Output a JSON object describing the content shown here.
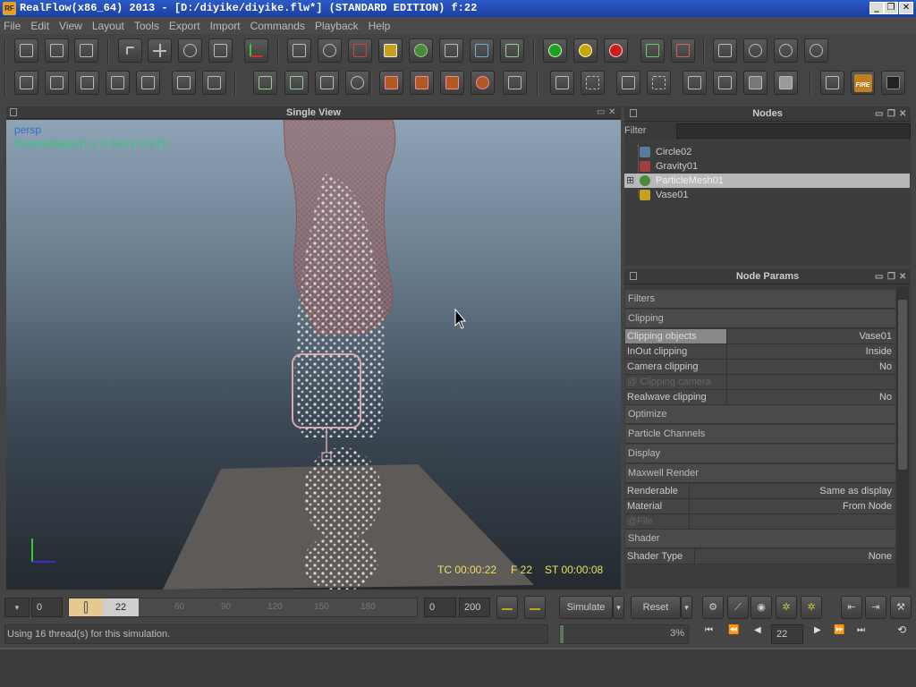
{
  "window": {
    "title": "RealFlow(x86_64) 2013 - [D:/diyike/diyike.flw*] (STANDARD EDITION) f:22",
    "logo_text": "RF"
  },
  "menu": [
    "File",
    "Edit",
    "View",
    "Layout",
    "Tools",
    "Export",
    "Import",
    "Commands",
    "Playback",
    "Help"
  ],
  "viewport": {
    "title": "Single View",
    "camera": "persp",
    "node_info": "ParticleMesh01 V 4 650 F 0 672",
    "timecode": "TC 00:00:22",
    "frame": "F 22",
    "sim_time": "ST 00:00:08"
  },
  "nodes": {
    "title": "Nodes",
    "filter_label": "Filter",
    "filter_value": "",
    "items": [
      {
        "name": "Circle02",
        "icon": "circle-emitter-icon",
        "color": "#5a7aa0",
        "selected": false
      },
      {
        "name": "Gravity01",
        "icon": "gravity-daemon-icon",
        "color": "#a04040",
        "selected": false
      },
      {
        "name": "ParticleMesh01",
        "icon": "particle-mesh-icon",
        "color": "#4a8a3a",
        "selected": true
      },
      {
        "name": "Vase01",
        "icon": "object-cube-icon",
        "color": "#c8a020",
        "selected": false
      }
    ]
  },
  "params": {
    "title": "Node Params",
    "sections": {
      "filters": "Filters",
      "clipping": "Clipping",
      "optimize": "Optimize",
      "channels": "Particle Channels",
      "display": "Display",
      "maxwell": "Maxwell Render",
      "shader": "Shader"
    },
    "clipping_rows": [
      {
        "key": "Clipping objects",
        "value": "Vase01"
      },
      {
        "key": "InOut clipping",
        "value": "Inside"
      },
      {
        "key": "Camera clipping",
        "value": "No"
      },
      {
        "key": "@ Clipping camera",
        "value": ""
      },
      {
        "key": "Realwave clipping",
        "value": "No"
      }
    ],
    "maxwell_rows": [
      {
        "key": "Renderable",
        "value": "Same as display"
      },
      {
        "key": "Material",
        "value": "From Node"
      },
      {
        "key": "@File",
        "value": ""
      }
    ],
    "shader_rows": [
      {
        "key": "Shader Type",
        "value": "None"
      }
    ]
  },
  "timeline": {
    "start": "0",
    "current": "22",
    "ticks": [
      "60",
      "90",
      "120",
      "150",
      "180"
    ],
    "range_start": "0",
    "range_end": "200",
    "simulate_label": "Simulate",
    "reset_label": "Reset",
    "frame_value": "22",
    "progress": "3%",
    "status": "Using 16 thread(s) for this simulation.",
    "playback_position": 0.11
  }
}
